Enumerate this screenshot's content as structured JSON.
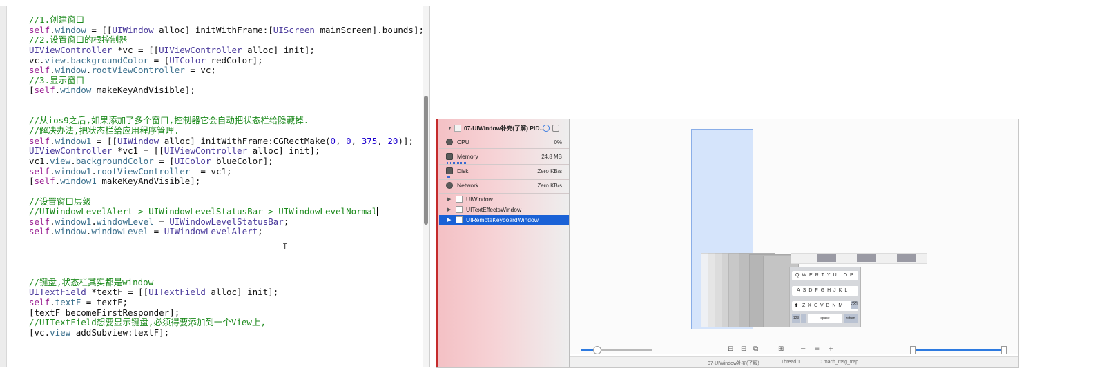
{
  "editor": {
    "lines": [
      [
        {
          "t": "//1.创建窗口",
          "c": "t-comment"
        }
      ],
      [
        {
          "t": "self",
          "c": "t-self"
        },
        {
          "t": ".",
          "c": "t-plain"
        },
        {
          "t": "window",
          "c": "t-prop"
        },
        {
          "t": " = [[",
          "c": "t-plain"
        },
        {
          "t": "UIWindow",
          "c": "t-type"
        },
        {
          "t": " alloc] initWithFrame:[",
          "c": "t-plain"
        },
        {
          "t": "UIScreen",
          "c": "t-type"
        },
        {
          "t": " mainScreen].bounds];",
          "c": "t-plain"
        }
      ],
      [
        {
          "t": "//2.设置窗口的根控制器",
          "c": "t-comment"
        }
      ],
      [
        {
          "t": "UIViewController",
          "c": "t-type"
        },
        {
          "t": " *vc = [[",
          "c": "t-plain"
        },
        {
          "t": "UIViewController",
          "c": "t-type"
        },
        {
          "t": " alloc] init];",
          "c": "t-plain"
        }
      ],
      [
        {
          "t": "vc.",
          "c": "t-plain"
        },
        {
          "t": "view",
          "c": "t-prop"
        },
        {
          "t": ".",
          "c": "t-plain"
        },
        {
          "t": "backgroundColor",
          "c": "t-prop"
        },
        {
          "t": " = [",
          "c": "t-plain"
        },
        {
          "t": "UIColor",
          "c": "t-type"
        },
        {
          "t": " redColor];",
          "c": "t-plain"
        }
      ],
      [
        {
          "t": "self",
          "c": "t-self"
        },
        {
          "t": ".",
          "c": "t-plain"
        },
        {
          "t": "window",
          "c": "t-prop"
        },
        {
          "t": ".",
          "c": "t-plain"
        },
        {
          "t": "rootViewController",
          "c": "t-prop"
        },
        {
          "t": " = vc;",
          "c": "t-plain"
        }
      ],
      [
        {
          "t": "//3.显示窗口",
          "c": "t-comment"
        }
      ],
      [
        {
          "t": "[",
          "c": "t-plain"
        },
        {
          "t": "self",
          "c": "t-self"
        },
        {
          "t": ".",
          "c": "t-plain"
        },
        {
          "t": "window",
          "c": "t-prop"
        },
        {
          "t": " makeKeyAndVisible];",
          "c": "t-plain"
        }
      ],
      [],
      [],
      [
        {
          "t": "//从ios9之后,如果添加了多个窗口,控制器它会自动把状态栏给隐藏掉.",
          "c": "t-comment"
        }
      ],
      [
        {
          "t": "//解决办法,把状态栏给应用程序管理.",
          "c": "t-comment"
        }
      ],
      [
        {
          "t": "self",
          "c": "t-self"
        },
        {
          "t": ".",
          "c": "t-plain"
        },
        {
          "t": "window1",
          "c": "t-prop"
        },
        {
          "t": " = [[",
          "c": "t-plain"
        },
        {
          "t": "UIWindow",
          "c": "t-type"
        },
        {
          "t": " alloc] initWithFrame:CGRectMake(",
          "c": "t-plain"
        },
        {
          "t": "0",
          "c": "t-num"
        },
        {
          "t": ", ",
          "c": "t-plain"
        },
        {
          "t": "0",
          "c": "t-num"
        },
        {
          "t": ", ",
          "c": "t-plain"
        },
        {
          "t": "375",
          "c": "t-num"
        },
        {
          "t": ", ",
          "c": "t-plain"
        },
        {
          "t": "20",
          "c": "t-num"
        },
        {
          "t": ")];",
          "c": "t-plain"
        }
      ],
      [
        {
          "t": "UIViewController",
          "c": "t-type"
        },
        {
          "t": " *vc1 = [[",
          "c": "t-plain"
        },
        {
          "t": "UIViewController",
          "c": "t-type"
        },
        {
          "t": " alloc] init];",
          "c": "t-plain"
        }
      ],
      [
        {
          "t": "vc1.",
          "c": "t-plain"
        },
        {
          "t": "view",
          "c": "t-prop"
        },
        {
          "t": ".",
          "c": "t-plain"
        },
        {
          "t": "backgroundColor",
          "c": "t-prop"
        },
        {
          "t": " = [",
          "c": "t-plain"
        },
        {
          "t": "UIColor",
          "c": "t-type"
        },
        {
          "t": " blueColor];",
          "c": "t-plain"
        }
      ],
      [
        {
          "t": "self",
          "c": "t-self"
        },
        {
          "t": ".",
          "c": "t-plain"
        },
        {
          "t": "window1",
          "c": "t-prop"
        },
        {
          "t": ".",
          "c": "t-plain"
        },
        {
          "t": "rootViewController",
          "c": "t-prop"
        },
        {
          "t": "  = vc1;",
          "c": "t-plain"
        }
      ],
      [
        {
          "t": "[",
          "c": "t-plain"
        },
        {
          "t": "self",
          "c": "t-self"
        },
        {
          "t": ".",
          "c": "t-plain"
        },
        {
          "t": "window1",
          "c": "t-prop"
        },
        {
          "t": " makeKeyAndVisible];",
          "c": "t-plain"
        }
      ],
      [],
      [
        {
          "t": "//设置窗口层级",
          "c": "t-comment"
        }
      ],
      [
        {
          "t": "//UIWindowLevelAlert > UIWindowLevelStatusBar > UIWindowLevelNormal",
          "c": "t-comment"
        },
        {
          "t": "|caret|",
          "c": "caret"
        }
      ],
      [
        {
          "t": "self",
          "c": "t-self"
        },
        {
          "t": ".",
          "c": "t-plain"
        },
        {
          "t": "window1",
          "c": "t-prop"
        },
        {
          "t": ".",
          "c": "t-plain"
        },
        {
          "t": "windowLevel",
          "c": "t-prop"
        },
        {
          "t": " = ",
          "c": "t-plain"
        },
        {
          "t": "UIWindowLevelStatusBar",
          "c": "t-type"
        },
        {
          "t": ";",
          "c": "t-plain"
        }
      ],
      [
        {
          "t": "self",
          "c": "t-self"
        },
        {
          "t": ".",
          "c": "t-plain"
        },
        {
          "t": "window",
          "c": "t-prop"
        },
        {
          "t": ".",
          "c": "t-plain"
        },
        {
          "t": "windowLevel",
          "c": "t-prop"
        },
        {
          "t": " = ",
          "c": "t-plain"
        },
        {
          "t": "UIWindowLevelAlert",
          "c": "t-type"
        },
        {
          "t": ";",
          "c": "t-plain"
        }
      ],
      [],
      [],
      [],
      [],
      [
        {
          "t": "//键盘,状态栏其实都是window",
          "c": "t-comment"
        }
      ],
      [
        {
          "t": "UITextField",
          "c": "t-type"
        },
        {
          "t": " *textF = [[",
          "c": "t-plain"
        },
        {
          "t": "UITextField",
          "c": "t-type"
        },
        {
          "t": " alloc] init];",
          "c": "t-plain"
        }
      ],
      [
        {
          "t": "self",
          "c": "t-self"
        },
        {
          "t": ".",
          "c": "t-plain"
        },
        {
          "t": "textF",
          "c": "t-prop"
        },
        {
          "t": " = textF;",
          "c": "t-plain"
        }
      ],
      [
        {
          "t": "[textF becomeFirstResponder];",
          "c": "t-plain"
        }
      ],
      [
        {
          "t": "//UITextField想要显示键盘,必须得要添加到一个View上,",
          "c": "t-comment"
        }
      ],
      [
        {
          "t": "[vc.",
          "c": "t-plain"
        },
        {
          "t": "view",
          "c": "t-prop"
        },
        {
          "t": " addSubview:textF];",
          "c": "t-plain"
        }
      ]
    ],
    "ibeam": "I"
  },
  "debugger": {
    "process_title": "07-UIWindow补充(了解) PID...",
    "gauges": [
      {
        "label": "CPU",
        "value": "0%"
      },
      {
        "label": "Memory",
        "value": "24.8 MB"
      },
      {
        "label": "Disk",
        "value": "Zero KB/s"
      },
      {
        "label": "Network",
        "value": "Zero KB/s"
      }
    ],
    "hierarchy": [
      {
        "label": "UIWindow",
        "selected": false
      },
      {
        "label": "UITextEffectsWindow",
        "selected": false
      },
      {
        "label": "UIRemoteKeyboardWindow",
        "selected": true
      }
    ],
    "keyboard_rows": [
      "QWERTYUIOP",
      "ASDFGHJKL",
      "ZXCVBNM"
    ],
    "keyboard_space": "space",
    "keyboard_return": "return",
    "keyboard_123": "123",
    "view_buttons": [
      "⊟",
      "⊟",
      "⧉",
      "⊞",
      "−",
      "=",
      "+"
    ],
    "bottom_bar": [
      "07-UIWindow补充(了解)",
      "Thread 1",
      "0 mach_msg_trap"
    ]
  }
}
